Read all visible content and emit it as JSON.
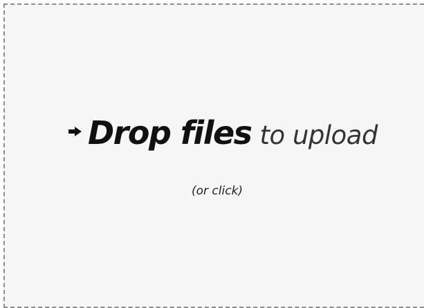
{
  "dropzone": {
    "icon": "arrow-right-icon",
    "strong_text": "Drop files",
    "light_text": "to upload",
    "hint": "(or click)"
  },
  "colors": {
    "background": "#f6f6f6",
    "border": "#8c8c8c",
    "text": "#111111"
  }
}
